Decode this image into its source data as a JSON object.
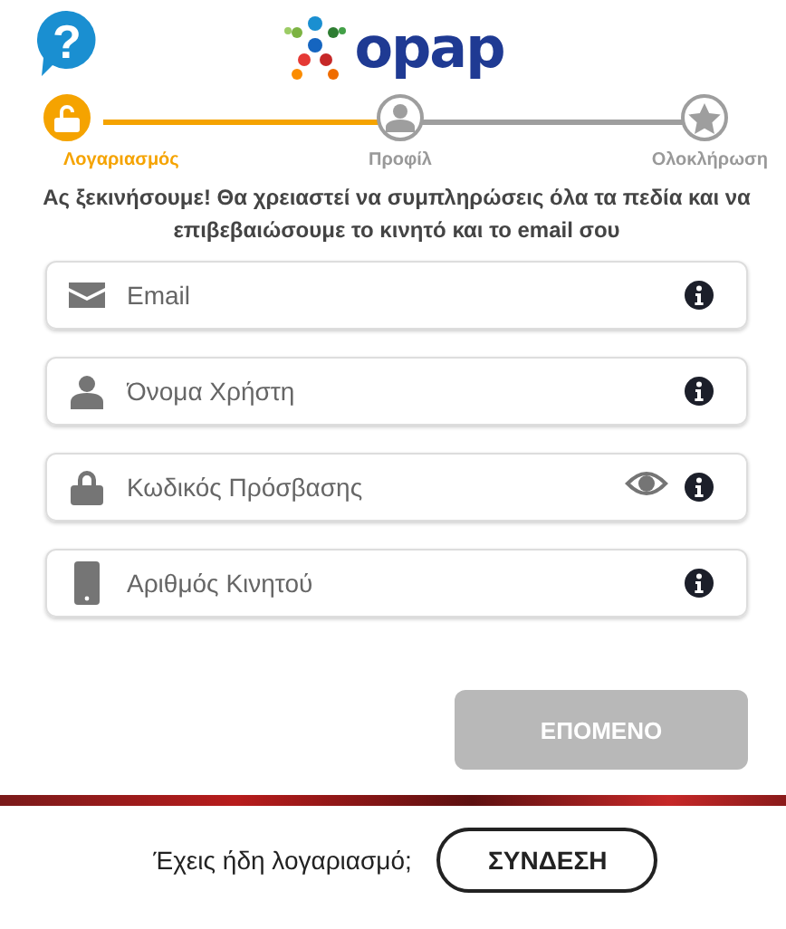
{
  "help": {
    "icon": "?"
  },
  "logo": {
    "text": "opap"
  },
  "steps": [
    {
      "label": "Λογαριασμός",
      "kind": "lock",
      "selected": true
    },
    {
      "label": "Προφίλ",
      "kind": "user",
      "selected": false
    },
    {
      "label": "Ολοκλήρωση",
      "kind": "star",
      "selected": false
    }
  ],
  "intro": "Ας ξεκινήσουμε! Θα χρειαστεί να συμπληρώσεις όλα τα πεδία και να επιβεβαιώσουμε το κινητό και το email σου",
  "fields": [
    {
      "kind": "email",
      "placeholder": "Email"
    },
    {
      "kind": "user",
      "placeholder": "Όνομα Χρήστη"
    },
    {
      "kind": "password",
      "placeholder": "Κωδικός Πρόσβασης"
    },
    {
      "kind": "phone",
      "placeholder": "Αριθμός Κινητού"
    }
  ],
  "next_button": {
    "label": "ΕΠΟΜΕΝΟ",
    "disabled": true
  },
  "footer": {
    "text": "Έχεις ήδη λογαριασμό;",
    "button": "ΣΥΝΔΕΣΗ"
  }
}
